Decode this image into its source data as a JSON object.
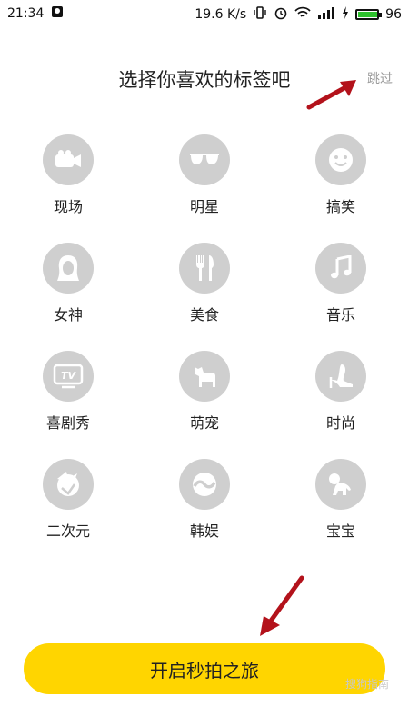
{
  "status_bar": {
    "time": "21:34",
    "speed": "19.6 K/s",
    "battery": "96",
    "battery_level": 0.96
  },
  "header": {
    "title": "选择你喜欢的标签吧",
    "skip_label": "跳过"
  },
  "tags": [
    {
      "label": "现场",
      "icon": "video-camera-icon"
    },
    {
      "label": "明星",
      "icon": "sunglasses-icon"
    },
    {
      "label": "搞笑",
      "icon": "smiley-icon"
    },
    {
      "label": "女神",
      "icon": "woman-icon"
    },
    {
      "label": "美食",
      "icon": "fork-knife-icon"
    },
    {
      "label": "音乐",
      "icon": "music-note-icon"
    },
    {
      "label": "喜剧秀",
      "icon": "tv-icon"
    },
    {
      "label": "萌宠",
      "icon": "dog-icon"
    },
    {
      "label": "时尚",
      "icon": "high-heel-icon"
    },
    {
      "label": "二次元",
      "icon": "anime-icon"
    },
    {
      "label": "韩娱",
      "icon": "korea-icon"
    },
    {
      "label": "宝宝",
      "icon": "baby-icon"
    }
  ],
  "cta": {
    "label": "开启秒拍之旅"
  },
  "watermark": "搜狗指南",
  "colors": {
    "accent": "#ffd500",
    "icon_bg": "#cfcfcf",
    "arrow": "#b3121b"
  }
}
